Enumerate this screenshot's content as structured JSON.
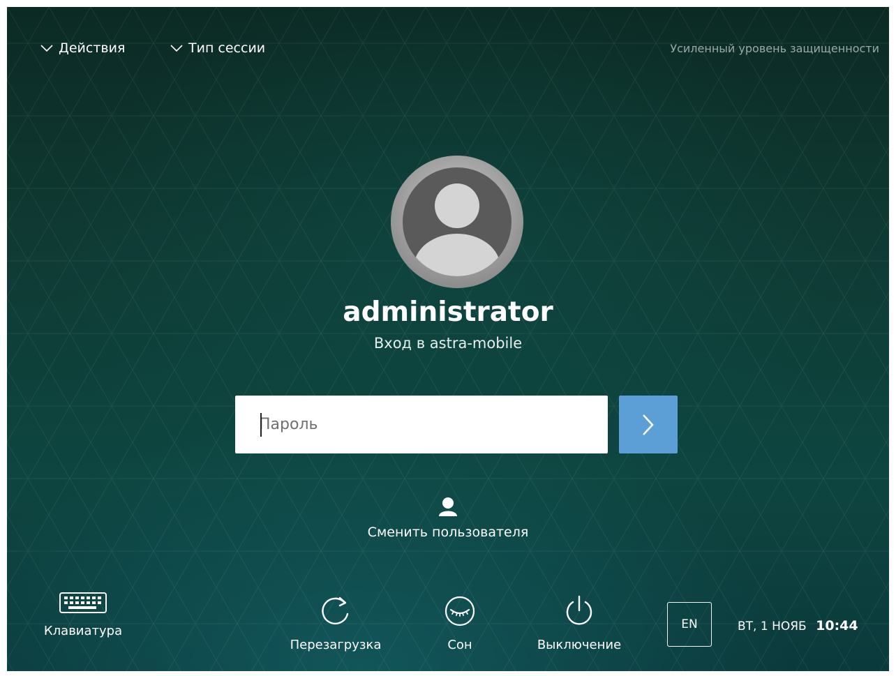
{
  "top_menu": {
    "actions_label": "Действия",
    "session_type_label": "Тип сессии"
  },
  "security_level": "Усиленный уровень защищенности",
  "user": {
    "name": "administrator",
    "login_subtitle": "Вход в astra-mobile"
  },
  "password": {
    "placeholder": "Пароль",
    "value": ""
  },
  "switch_user_label": "Сменить пользователя",
  "bottom": {
    "keyboard_label": "Клавиатура",
    "reboot_label": "Перезагрузка",
    "sleep_label": "Сон",
    "shutdown_label": "Выключение",
    "language": "EN",
    "date": "ВТ, 1 НОЯБ",
    "time": "10:44"
  },
  "colors": {
    "background": "#0f3a33",
    "submit_button": "#5b9fd6",
    "security_text": "#9aaaa6"
  },
  "icons": {
    "top_menu": "chevron-down-icon",
    "avatar": "user-avatar-icon",
    "submit": "chevron-right-icon",
    "switch_user": "user-icon",
    "keyboard": "keyboard-icon",
    "reboot": "reboot-icon",
    "sleep": "sleep-icon",
    "shutdown": "power-icon"
  }
}
